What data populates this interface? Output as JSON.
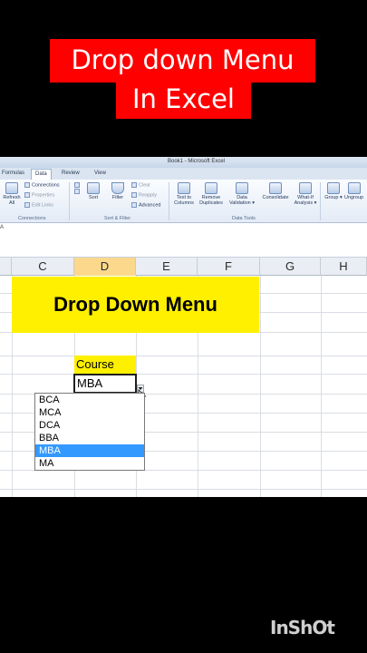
{
  "overlay": {
    "title_line1": "Drop down Menu",
    "title_line2": "In Excel",
    "watermark": "InShOt"
  },
  "window": {
    "title": "Book1 - Microsoft Excel"
  },
  "tabs": [
    {
      "label": "Formulas"
    },
    {
      "label": "Data"
    },
    {
      "label": "Review"
    },
    {
      "label": "View"
    }
  ],
  "ribbon": {
    "refresh_line1": "Refresh",
    "refresh_line2": "All",
    "connections": "Connections",
    "properties": "Properties",
    "edit_links": "Edit Links",
    "group_connections": "Connections",
    "sort": "Sort",
    "filter": "Filter",
    "clear": "Clear",
    "reapply": "Reapply",
    "advanced": "Advanced",
    "group_sort_filter": "Sort & Filter",
    "text_to_line1": "Text to",
    "text_to_line2": "Columns",
    "remove_line1": "Remove",
    "remove_line2": "Duplicates",
    "data_val_line1": "Data",
    "data_val_line2": "Validation",
    "consolidate": "Consolidate",
    "whatif_line1": "What-If",
    "whatif_line2": "Analysis",
    "group_data_tools": "Data Tools",
    "group_btn": "Group",
    "ungroup_btn": "Ungroup"
  },
  "formula_bar": {
    "name_box": "A"
  },
  "columns": [
    {
      "label": "C"
    },
    {
      "label": "D"
    },
    {
      "label": "E"
    },
    {
      "label": "F"
    },
    {
      "label": "G"
    },
    {
      "label": "H"
    }
  ],
  "sheet": {
    "banner": "Drop Down Menu",
    "course_label": "Course",
    "input_value": "MBA",
    "options": [
      "BCA",
      "MCA",
      "DCA",
      "BBA",
      "MBA",
      "MA"
    ],
    "selected_option": "MBA"
  }
}
